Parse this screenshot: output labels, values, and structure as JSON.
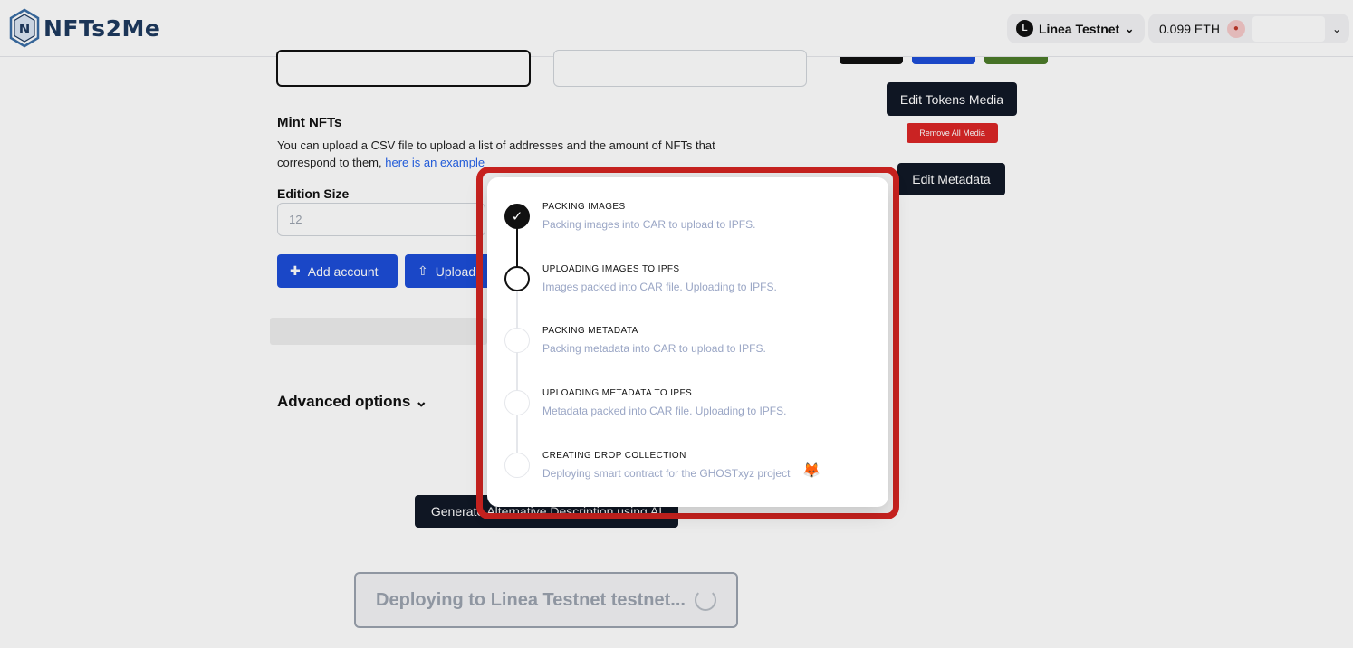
{
  "header": {
    "logo_text": "NFTs2Me",
    "network_label": "Linea Testnet",
    "balance": "0.099 ETH"
  },
  "mint": {
    "title": "Mint NFTs",
    "description": "You can upload a CSV file to upload a list of addresses and the amount of NFTs that correspond to them,",
    "example_link": "here is an example",
    "edition_label": "Edition Size",
    "edition_value": "12",
    "add_account": "Add account",
    "upload": "Upload"
  },
  "advanced_options": "Advanced options",
  "generate_button": "Generate Alternative Description using AI",
  "deploy_button": "Deploying to Linea Testnet testnet...",
  "side": {
    "edit_tokens_media": "Edit Tokens Media",
    "remove_all_media": "Remove All Media",
    "edit_metadata": "Edit Metadata"
  },
  "modal": {
    "steps": [
      {
        "title": "PACKING IMAGES",
        "desc": "Packing images into CAR to upload to IPFS.",
        "state": "done"
      },
      {
        "title": "UPLOADING IMAGES TO IPFS",
        "desc": "Images packed into CAR file. Uploading to IPFS.",
        "state": "active"
      },
      {
        "title": "PACKING METADATA",
        "desc": "Packing metadata into CAR to upload to IPFS.",
        "state": "pending"
      },
      {
        "title": "UPLOADING METADATA TO IPFS",
        "desc": "Metadata packed into CAR file. Uploading to IPFS.",
        "state": "pending"
      },
      {
        "title": "CREATING DROP COLLECTION",
        "desc": "Deploying smart contract for the GHOSTxyz project",
        "state": "pending"
      }
    ]
  },
  "icons": {
    "logo": "nfts2me-logo-icon",
    "network": "linea-network-icon",
    "check": "check-icon",
    "fox": "metamask-fox-icon",
    "spinner": "spinner-icon"
  },
  "colors": {
    "primary_blue": "#1d4ed8",
    "highlight_red": "#c8221f",
    "danger": "#dc2626",
    "dark": "#111827"
  }
}
